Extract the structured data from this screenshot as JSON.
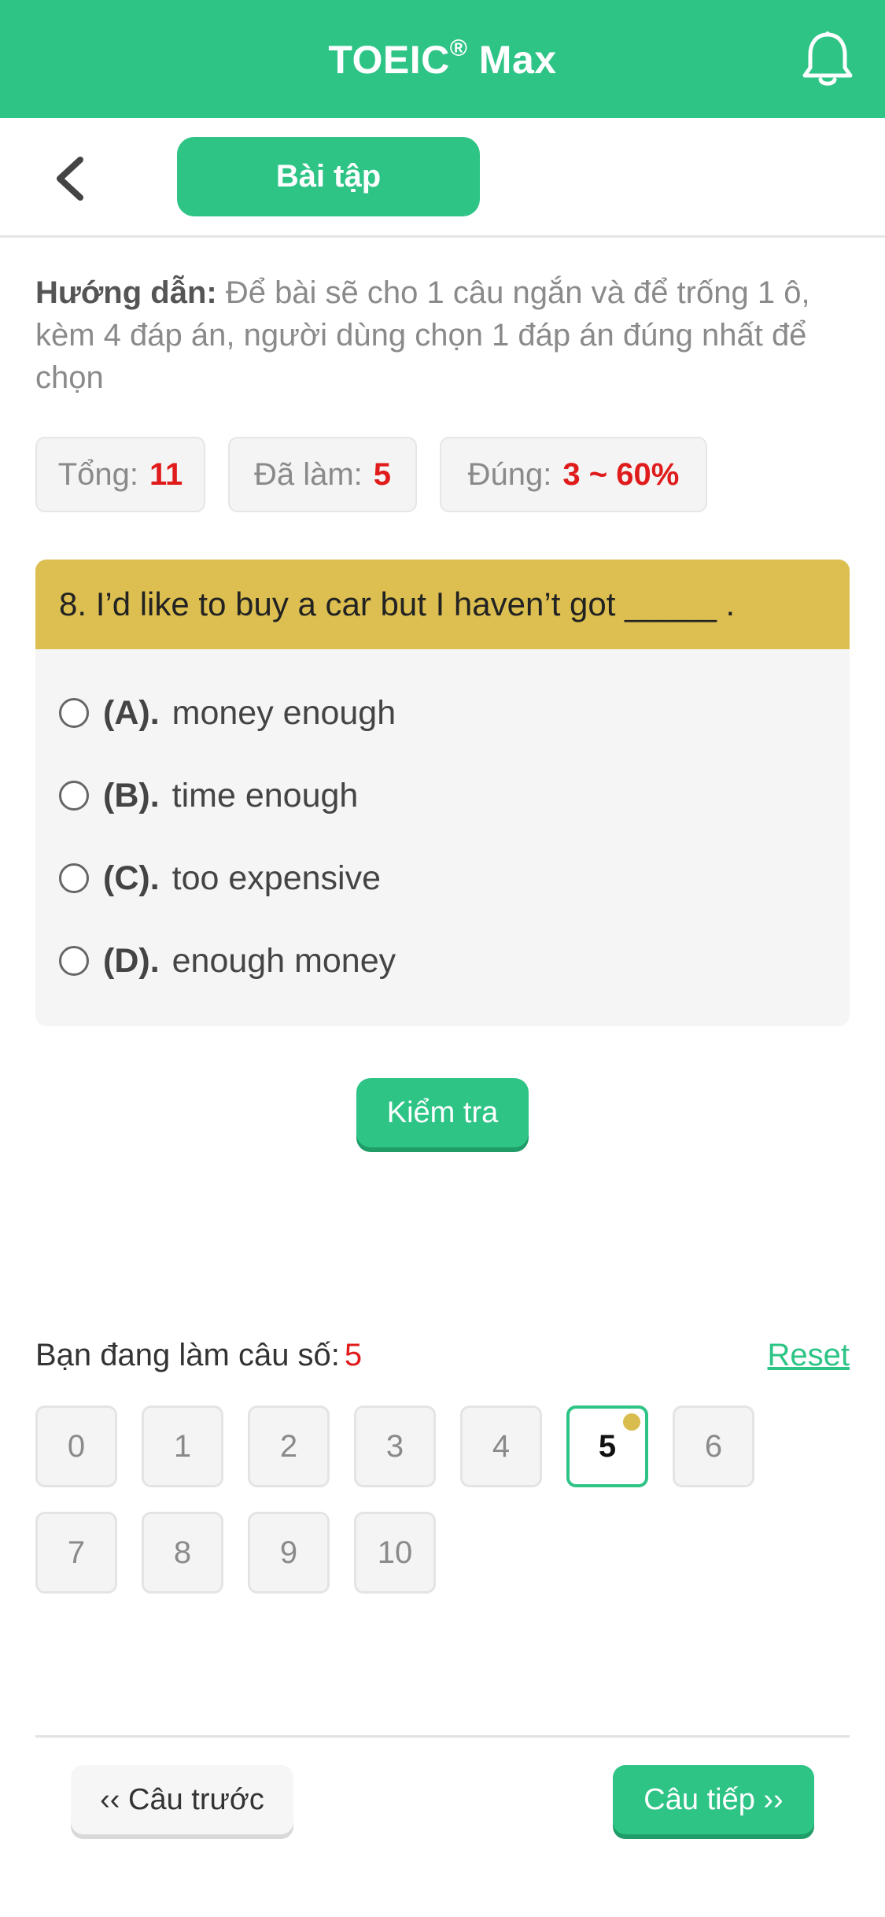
{
  "header": {
    "title": "TOEIC",
    "title_mark": "®",
    "title_suffix": " Max",
    "icon": "bell-icon"
  },
  "subnav": {
    "back_icon": "chevron-left-icon",
    "tab_label": "Bài tập"
  },
  "instructions": {
    "label": "Hướng dẫn:",
    "text": " Để bài sẽ cho 1 câu ngắn và để trống 1 ô, kèm 4 đáp án, người dùng chọn 1 đáp án đúng nhất để chọn"
  },
  "stats": {
    "total_label": "Tổng:",
    "total_value": "11",
    "done_label": "Đã làm:",
    "done_value": "5",
    "correct_label": "Đúng:",
    "correct_value": "3 ~ 60%"
  },
  "question": {
    "text": "8. I’d like to buy a car but I haven’t got _____ .",
    "options": [
      {
        "key": "(A).",
        "text": "money enough"
      },
      {
        "key": "(B).",
        "text": "time enough"
      },
      {
        "key": "(C).",
        "text": "too expensive"
      },
      {
        "key": "(D).",
        "text": "enough money"
      }
    ]
  },
  "check_label": "Kiểm tra",
  "progress": {
    "doing_label": "Bạn đang làm câu số:",
    "doing_value": "5",
    "reset_label": "Reset",
    "numbers": [
      "0",
      "1",
      "2",
      "3",
      "4",
      "5",
      "6",
      "7",
      "8",
      "9",
      "10"
    ],
    "active_index": 5
  },
  "footer": {
    "prev_label": "‹‹ Câu trước",
    "next_label": "Câu tiếp ››"
  },
  "colors": {
    "primary": "#2ec486",
    "question_bar": "#dcbf50",
    "highlight": "#e01b1b"
  }
}
